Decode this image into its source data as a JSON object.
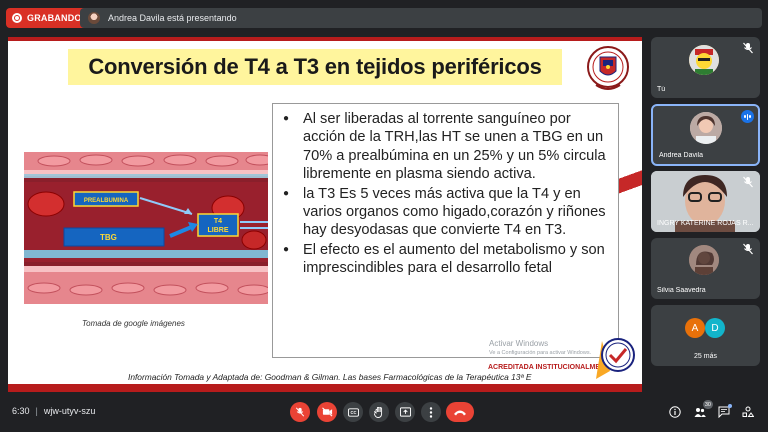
{
  "topbar": {
    "recording_label": "GRABANDO",
    "presenting_text": "Andrea Davila está presentando"
  },
  "slide": {
    "title": "Conversión de T4 a T3 en tejidos periféricos",
    "bullets": [
      "Al ser  liberadas al torrente sanguíneo por acción de la TRH,las HT se unen a TBG en un 70% a prealbúmina en un 25% y un 5% circula libremente en plasma siendo activa.",
      "la T3 Es 5 veces más activa que la T4 y en varios organos como higado,corazón y riñones hay desyodasas que convierte T4 en T3.",
      "El efecto es el aumento  del metabolismo y son imprescindibles para el desarrollo fetal"
    ],
    "image_labels": {
      "prealbumina": "PREALBUMINA",
      "tbg": "TBG",
      "t4_libre_line1": "T4",
      "t4_libre_line2": "LIBRE"
    },
    "image_caption": "Tomada de google imágenes",
    "watermark_line1": "Activar Windows",
    "watermark_line2": "Ve a Configuración para activar Windows.",
    "acreditada": "ACREDITADA INSTITUCIONALMENTE",
    "footer": "Información Tomada y Adaptada de: Goodman & Gilman. Las bases Farmacológicas de la Terapéutica 13ª E"
  },
  "participants": {
    "tiles": [
      {
        "name": "Tú"
      },
      {
        "name": "Andrea Davila"
      },
      {
        "name": "INGRY KATERINE ROJAS R..."
      },
      {
        "name": "Silvia Saavedra"
      }
    ],
    "more": {
      "initial_a": "A",
      "initial_d": "D",
      "label": "25 más"
    }
  },
  "bottombar": {
    "time": "6:30",
    "meeting_code": "wjw-utyv-szu",
    "people_count": "30"
  },
  "colors": {
    "recording": "#d93025",
    "hangup": "#ea4335",
    "active_border": "#8ab4f8",
    "title_highlight": "#fff59d",
    "slide_accent": "#b71c1c"
  },
  "icons": [
    "record-icon",
    "mic-off-icon",
    "camera-off-icon",
    "captions-icon",
    "raise-hand-icon",
    "present-icon",
    "more-options-icon",
    "hangup-icon",
    "info-icon",
    "people-icon",
    "chat-icon",
    "activities-icon"
  ]
}
